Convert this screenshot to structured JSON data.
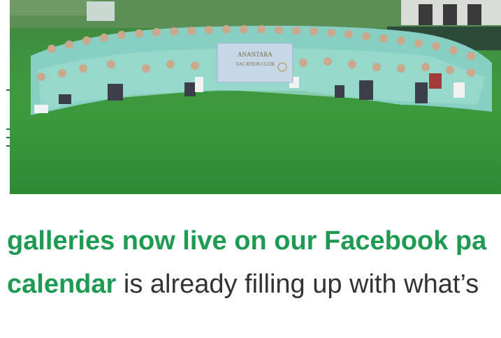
{
  "photo": {
    "banner_text_1": "ANANTARA",
    "banner_text_2": "VACATION CLUB"
  },
  "text": {
    "line1": "galleries now live on our Facebook pa",
    "line2_link": "calendar",
    "line2_rest": " is already filling up with what’s"
  },
  "colors": {
    "link_green": "#1f9a52",
    "body_text": "#333333",
    "grass": "#3c9a3d",
    "shirt": "#8fd6c9"
  }
}
